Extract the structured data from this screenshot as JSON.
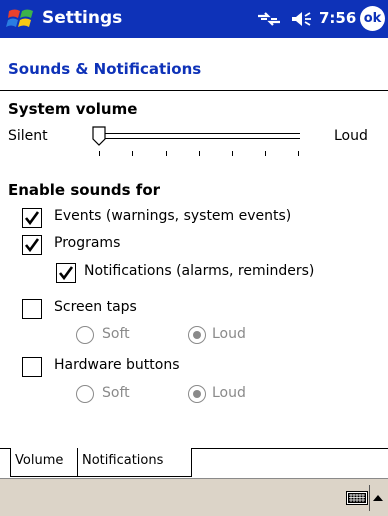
{
  "titlebar": {
    "app_title": "Settings",
    "clock": "7:56",
    "ok_label": "ok"
  },
  "header": {
    "title": "Sounds & Notifications"
  },
  "volume": {
    "section_title": "System volume",
    "min_label": "Silent",
    "max_label": "Loud",
    "level": 0,
    "tick_count": 7
  },
  "sounds": {
    "section_title": "Enable sounds for",
    "events": {
      "label": "Events (warnings, system events)",
      "checked": true
    },
    "programs": {
      "label": "Programs",
      "checked": true
    },
    "notifications": {
      "label": "Notifications (alarms, reminders)",
      "checked": true
    },
    "screen_taps": {
      "label": "Screen taps",
      "checked": false,
      "soft_label": "Soft",
      "loud_label": "Loud",
      "selected": "Loud"
    },
    "hardware_buttons": {
      "label": "Hardware buttons",
      "checked": false,
      "soft_label": "Soft",
      "loud_label": "Loud",
      "selected": "Loud"
    }
  },
  "tabs": [
    {
      "label": "Volume",
      "active": true
    },
    {
      "label": "Notifications",
      "active": false
    }
  ],
  "colors": {
    "title_bar": "#0e32b8",
    "header_text": "#0e32b8",
    "bottom_bar": "#dcd4c8",
    "disabled_text": "#8a8a8a"
  }
}
